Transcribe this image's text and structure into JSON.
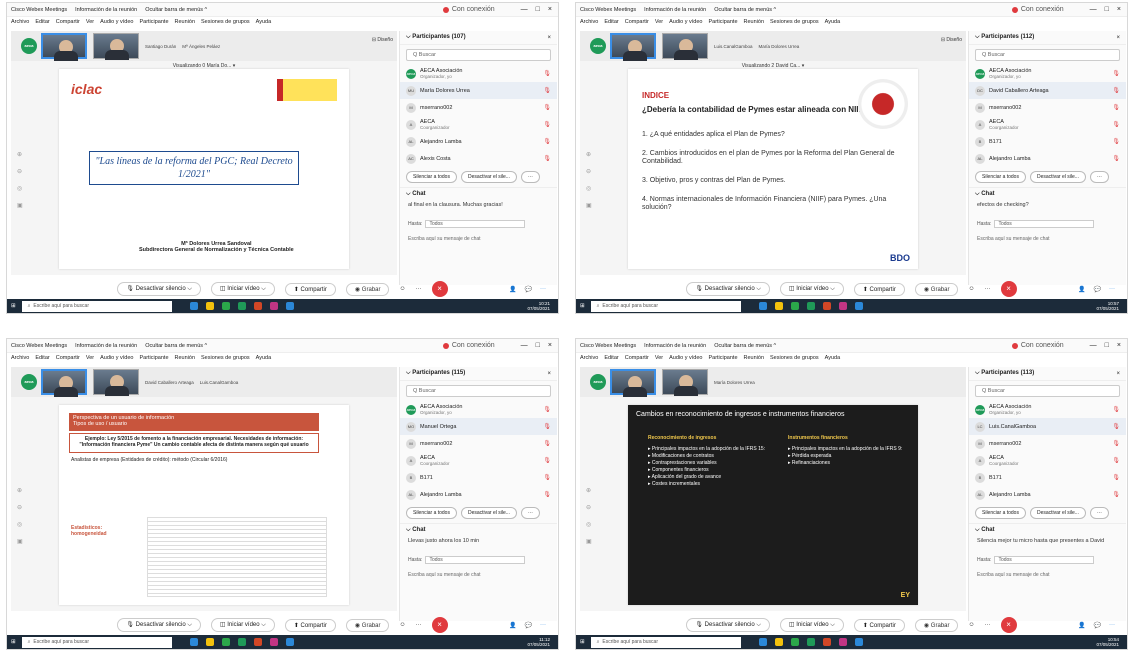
{
  "app": {
    "title": "Cisco Webex Meetings",
    "info": "Información de la reunión",
    "hide": "Ocultar barra de menús ^",
    "conn": "Con conexión",
    "menu": [
      "Archivo",
      "Editar",
      "Compartir",
      "Ver",
      "Audio y vídeo",
      "Participante",
      "Reunión",
      "Sesiones de grupos",
      "Ayuda"
    ]
  },
  "controls": {
    "mute": "Desactivar silencio",
    "video": "Iniciar vídeo",
    "share": "Compartir",
    "record": "Grabar"
  },
  "panel": {
    "search": "Buscar",
    "silence_all": "Silenciar a todos",
    "deact": "Desactivar el sile...",
    "chat": "Chat",
    "hasta": "Hasta:",
    "todos": "Todos",
    "chat_ph": "Escriba aquí su mensaje de chat"
  },
  "taskbar": {
    "search": "Escribe aquí para buscar"
  },
  "quads": [
    {
      "header": "Participantes (107)",
      "names": [
        "Santiago Durán",
        "Mª Ángeles Peláez"
      ],
      "thumb_sel": "Enrique Ortega",
      "view": "Diseño",
      "visual": "Visualizando 0 María Do... ▾",
      "participants": [
        {
          "i": "",
          "n": "AECA Asociación",
          "s": "Organizador, yo"
        },
        {
          "i": "MU",
          "n": "María Dolores Urrea",
          "s": ""
        },
        {
          "i": "M",
          "n": "mserrano002",
          "s": ""
        },
        {
          "i": "A",
          "n": "AECA",
          "s": "Coorganizador"
        },
        {
          "i": "AL",
          "n": "Alejandro Lamba",
          "s": ""
        },
        {
          "i": "AC",
          "n": "Alexis Costa",
          "s": ""
        }
      ],
      "chat": "al final en la clausura. Muchas gracias!",
      "clock": [
        "10:21",
        "07/05/2021"
      ]
    },
    {
      "header": "Participantes (112)",
      "names": [
        "Luis.CanalGamboa",
        "María Dolores Urrea"
      ],
      "thumb_sel": "David Caballero Artea...",
      "view": "Diseño",
      "visual": "Visualizando 2 David Ca... ▾",
      "participants": [
        {
          "i": "",
          "n": "AECA Asociación",
          "s": "Organizador, yo"
        },
        {
          "i": "DC",
          "n": "David Caballero Arteaga",
          "s": ""
        },
        {
          "i": "M",
          "n": "mserrano002",
          "s": ""
        },
        {
          "i": "A",
          "n": "AECA",
          "s": "Coorganizador"
        },
        {
          "i": "B",
          "n": "B171",
          "s": ""
        },
        {
          "i": "AL",
          "n": "Alejandro Lamba",
          "s": ""
        }
      ],
      "chat": "efectos de checking?",
      "clock": [
        "10:57",
        "07/05/2021"
      ]
    },
    {
      "header": "Participantes (115)",
      "names": [
        "David Caballero Arteaga",
        "Luis.CanalGamboa"
      ],
      "thumb_sel": "",
      "view": "",
      "visual": "",
      "participants": [
        {
          "i": "",
          "n": "AECA Asociación",
          "s": "Organizador, yo"
        },
        {
          "i": "MO",
          "n": "Manuel Ortega",
          "s": ""
        },
        {
          "i": "M",
          "n": "mserrano002",
          "s": ""
        },
        {
          "i": "A",
          "n": "AECA",
          "s": "Coorganizador"
        },
        {
          "i": "B",
          "n": "B171",
          "s": ""
        },
        {
          "i": "AL",
          "n": "Alejandro Lamba",
          "s": ""
        }
      ],
      "chat": "Llevas justo ahora los 10 min",
      "clock": [
        "11:12",
        "07/05/2021"
      ]
    },
    {
      "header": "Participantes (113)",
      "names": [
        "María Dolores Urrea"
      ],
      "thumb_sel": "",
      "view": "",
      "visual": "",
      "participants": [
        {
          "i": "",
          "n": "AECA Asociación",
          "s": "Organizador, yo"
        },
        {
          "i": "LC",
          "n": "Luis.CanalGamboa",
          "s": ""
        },
        {
          "i": "M",
          "n": "mserrano002",
          "s": ""
        },
        {
          "i": "A",
          "n": "AECA",
          "s": "Coorganizador"
        },
        {
          "i": "B",
          "n": "B171",
          "s": ""
        },
        {
          "i": "AL",
          "n": "Alejandro Lamba",
          "s": ""
        }
      ],
      "chat": "Silencia mejor tu micro hasta que presentes a David",
      "clock": [
        "10:54",
        "07/05/2021"
      ]
    }
  ],
  "slides": {
    "s0": {
      "iclac": "iclac",
      "title": "\"Las líneas de la reforma del PGC; Real Decreto 1/2021\"",
      "auth": "Mª Dolores Urrea Sandoval",
      "auth2": "Subdirectora General de Normalización y Técnica Contable"
    },
    "s1": {
      "idx": "INDICE",
      "q": "¿Debería la contabilidad de Pymes estar alineada con NIIF?",
      "items": [
        "1. ¿A qué entidades aplica el Plan de Pymes?",
        "2. Cambios introducidos en el plan de Pymes por la Reforma del Plan General de Contabilidad.",
        "3. Objetivo, pros y contras del Plan de Pymes.",
        "4. Normas internacionales de Información Financiera (NIIF) para Pymes. ¿Una solución?"
      ],
      "bdo": "BDO"
    },
    "s2": {
      "hd": "Perspectiva de un usuario de información",
      "hd2": "Tipos de uso / usuario",
      "box": "Ejemplo: Ley 5/2015 de fomento a la financiación empresarial. Necesidades de información: \"Información financiera Pyme\" Un cambio contable afecta de distinta manera según qué usuario",
      "an": "Analistas de empresa (Entidades de crédito): método (Circular 6/2016)",
      "est": "Estadísticos: homogeneidad"
    },
    "s3": {
      "ht": "Cambios en reconocimiento de ingresos e instrumentos financieros",
      "c1": "Reconocimiento de ingresos",
      "c1i": [
        "Principales impactos en la adopción de la IFRS 15:",
        "Modificaciones de contratos",
        "Contraprestaciones variables",
        "Componentes financieros",
        "Aplicación del grado de avance",
        "Costes incrementales"
      ],
      "c2": "Instrumentos financieros",
      "c2i": [
        "Principales impactos en la adopción de la IFRS 9:",
        "Pérdida esperada",
        "Refinanciaciones"
      ],
      "ey": "EY"
    }
  }
}
